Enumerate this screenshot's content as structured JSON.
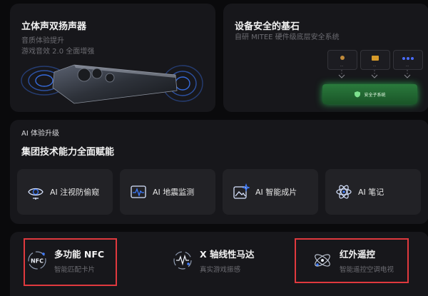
{
  "speaker": {
    "title": "立体声双扬声器",
    "lines": [
      "音质体验提升",
      "游戏音效 2.0 全面增强"
    ]
  },
  "security": {
    "title": "设备安全的基石",
    "subtitle": "自研 MITEE 硬件级底层安全系统",
    "chip_label": "安全子系统"
  },
  "ai": {
    "small_label": "AI 体验升级",
    "heading": "集团技术能力全面赋能",
    "features": [
      {
        "icon": "eye-shield-icon",
        "label": "AI 注视防偷窥"
      },
      {
        "icon": "seismic-wave-icon",
        "label": "AI 地震监测"
      },
      {
        "icon": "image-sparkle-icon",
        "label": "AI 智能成片"
      },
      {
        "icon": "atom-icon",
        "label": "AI 笔记"
      }
    ]
  },
  "bottom": [
    {
      "icon": "nfc-icon",
      "title": "多功能 NFC",
      "subtitle": "智能匹配卡片",
      "highlighted": true
    },
    {
      "icon": "vibration-motor-icon",
      "title": "X 轴线性马达",
      "subtitle": "真实游戏振感",
      "highlighted": false
    },
    {
      "icon": "infrared-remote-icon",
      "title": "红外遥控",
      "subtitle": "智能遥控空调电视",
      "highlighted": true
    }
  ],
  "colors": {
    "background": "#0a0a0c",
    "card": "#17171b",
    "feature_tile": "#222226",
    "highlight_border": "#e0393e",
    "accent_blue": "#3d7bff",
    "secure_green": "#2aa04a"
  }
}
